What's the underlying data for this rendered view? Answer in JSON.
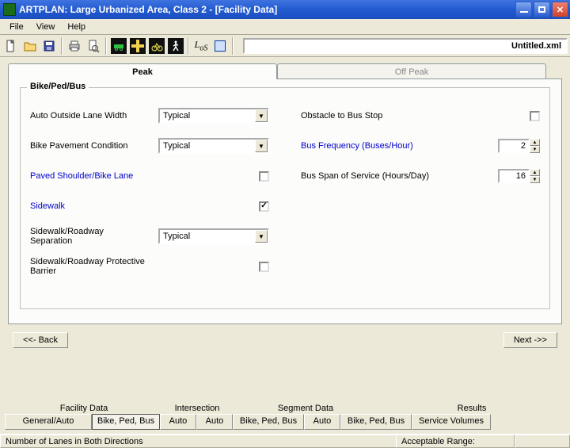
{
  "window": {
    "title": "ARTPLAN: Large Urbanized Area, Class 2 - [Facility Data]"
  },
  "menu": {
    "items": [
      {
        "label": "File"
      },
      {
        "label": "View"
      },
      {
        "label": "Help"
      }
    ]
  },
  "toolbar": {
    "filename": "Untitled.xml"
  },
  "tabs": {
    "active": {
      "label": "Peak"
    },
    "inactive": {
      "label": "Off Peak"
    }
  },
  "group": {
    "legend": "Bike/Ped/Bus"
  },
  "left_fields": {
    "auto_outside_lane_width": {
      "label": "Auto Outside Lane Width",
      "value": "Typical"
    },
    "bike_pavement_condition": {
      "label": "Bike Pavement Condition",
      "value": "Typical"
    },
    "paved_shoulder": {
      "label": "Paved Shoulder/Bike Lane",
      "checked": ""
    },
    "sidewalk": {
      "label": "Sidewalk",
      "checked": "✓"
    },
    "sidewalk_sep": {
      "label": "Sidewalk/Roadway Separation",
      "value": "Typical"
    },
    "sidewalk_barrier": {
      "label": "Sidewalk/Roadway Protective Barrier",
      "checked": ""
    }
  },
  "right_fields": {
    "obstacle_bus_stop": {
      "label": "Obstacle to Bus Stop",
      "checked": ""
    },
    "bus_frequency": {
      "label": "Bus Frequency (Buses/Hour)",
      "value": "2"
    },
    "bus_span": {
      "label": "Bus Span of Service (Hours/Day)",
      "value": "16"
    }
  },
  "nav": {
    "back": "<<-  Back",
    "next": "Next  ->>"
  },
  "bottom": {
    "headers": {
      "facility_data": "Facility Data",
      "intersection": "Intersection",
      "segment_data": "Segment Data",
      "results": "Results"
    },
    "tabs": {
      "general_auto": "General/Auto",
      "bike_ped_bus1": "Bike, Ped, Bus",
      "auto1": "Auto",
      "auto2": "Auto",
      "bike_ped_bus2": "Bike, Ped, Bus",
      "auto3": "Auto",
      "bike_ped_bus3": "Bike, Ped, Bus",
      "service_volumes": "Service Volumes"
    }
  },
  "status": {
    "hint": "Number of Lanes in Both Directions",
    "range_label": "Acceptable Range:",
    "range_value": ""
  }
}
